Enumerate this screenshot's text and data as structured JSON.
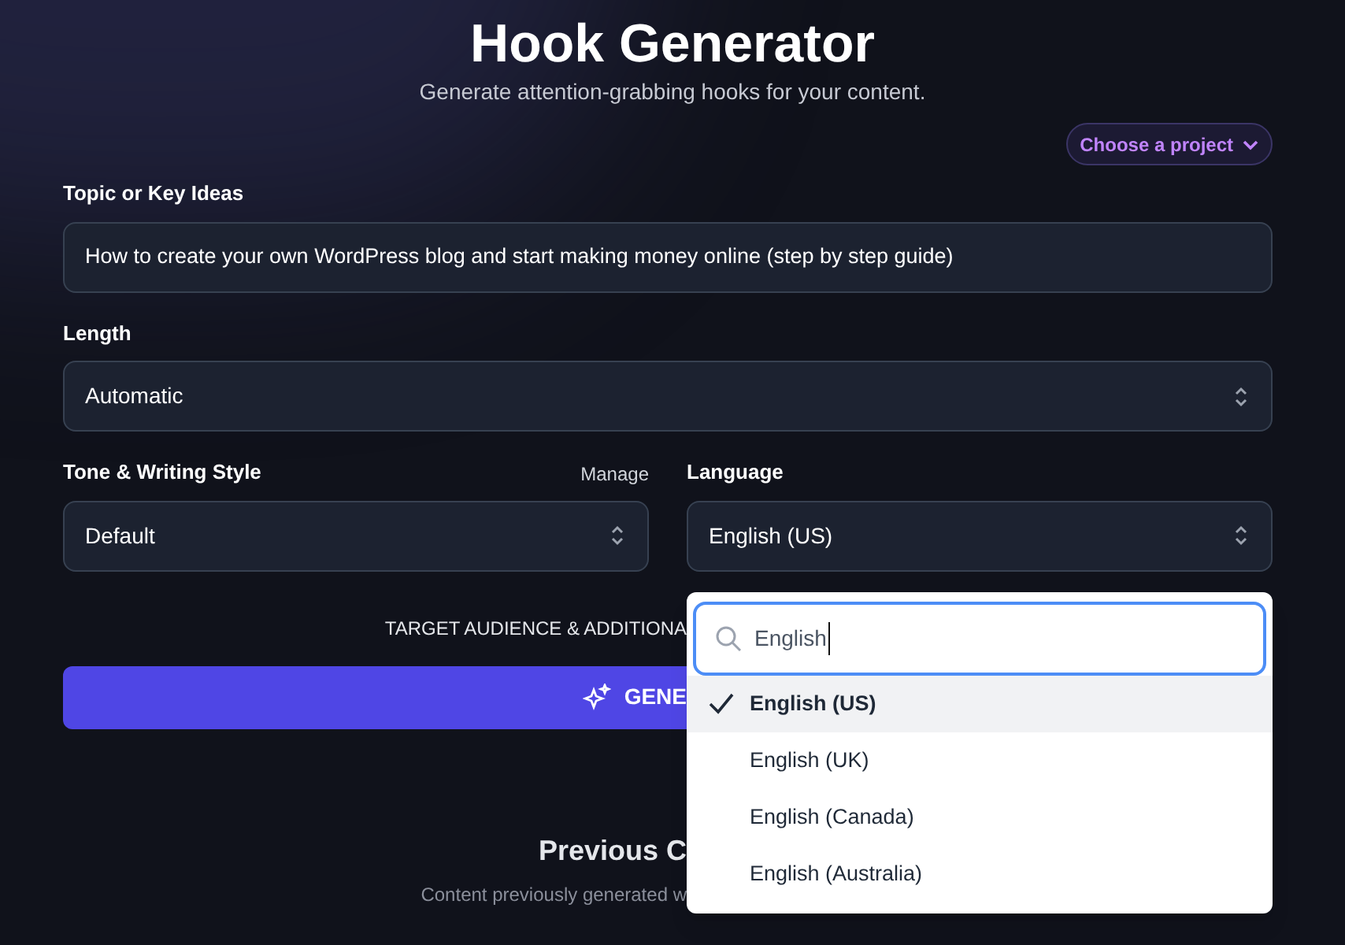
{
  "header": {
    "title": "Hook Generator",
    "subtitle": "Generate attention-grabbing hooks for your content."
  },
  "project_button": {
    "label": "Choose a project"
  },
  "topic": {
    "label": "Topic or Key Ideas",
    "value": "How to create your own WordPress blog and start making money online (step by step guide)"
  },
  "length": {
    "label": "Length",
    "value": "Automatic"
  },
  "tone": {
    "label": "Tone & Writing Style",
    "action": "Manage",
    "value": "Default"
  },
  "language": {
    "label": "Language",
    "value": "English (US)",
    "dropdown": {
      "search": "English",
      "options": [
        {
          "label": "English (US)",
          "selected": true
        },
        {
          "label": "English (UK)",
          "selected": false
        },
        {
          "label": "English (Canada)",
          "selected": false
        },
        {
          "label": "English (Australia)",
          "selected": false
        }
      ]
    }
  },
  "advanced_toggle": "TARGET AUDIENCE & ADDITIONA",
  "generate_button": {
    "label": "GENE"
  },
  "previous": {
    "title": "Previous C",
    "subtitle": "Content previously generated w"
  }
}
